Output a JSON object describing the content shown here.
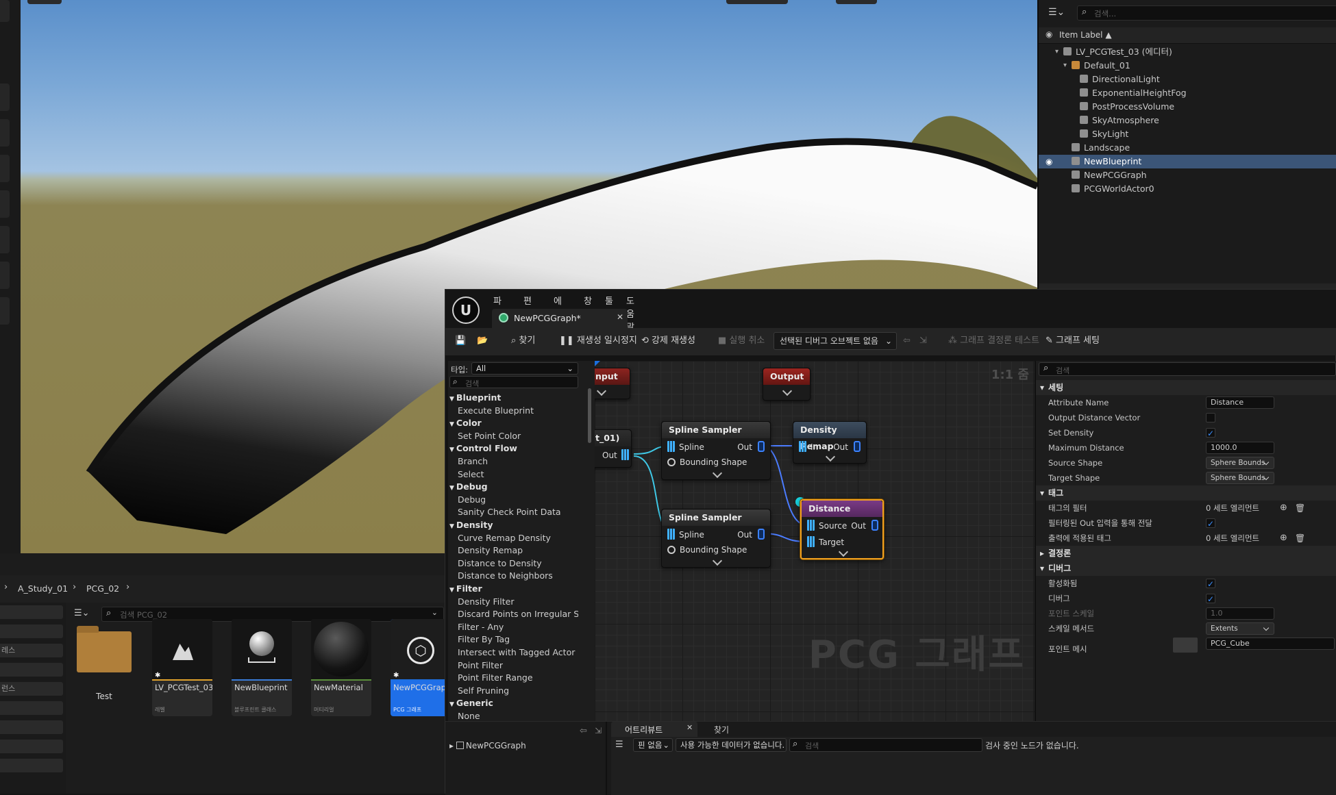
{
  "outliner": {
    "search_placeholder": "검색...",
    "column_label": "Item Label ▲",
    "items": [
      {
        "label": "LV_PCGTest_03 (에디터)",
        "indent": 0
      },
      {
        "label": "Default_01",
        "indent": 1
      },
      {
        "label": "DirectionalLight",
        "indent": 2
      },
      {
        "label": "ExponentialHeightFog",
        "indent": 2
      },
      {
        "label": "PostProcessVolume",
        "indent": 2
      },
      {
        "label": "SkyAtmosphere",
        "indent": 2
      },
      {
        "label": "SkyLight",
        "indent": 2
      },
      {
        "label": "Landscape",
        "indent": 1
      },
      {
        "label": "NewBlueprint",
        "indent": 1,
        "selected": true
      },
      {
        "label": "NewPCGGraph",
        "indent": 1
      },
      {
        "label": "PCGWorldActor0",
        "indent": 1
      }
    ]
  },
  "content_browser": {
    "breadcrumb": [
      "A_Study_01",
      "PCG_02"
    ],
    "search_placeholder": "검색 PCG_02",
    "side_labels": [
      "레스",
      "런스"
    ],
    "assets": [
      {
        "name": "Test",
        "type": "",
        "kind": "folder"
      },
      {
        "name": "LV_PCGTest_03",
        "type": "레벨",
        "kind": "level",
        "accent": "#e0a22c"
      },
      {
        "name": "NewBlueprint",
        "type": "블루프린트 클래스",
        "kind": "blueprint",
        "accent": "#3b7cd8"
      },
      {
        "name": "NewMaterial",
        "type": "머티리얼",
        "kind": "material",
        "accent": "#5a8f3a"
      },
      {
        "name": "NewPCGGraph",
        "type": "PCG 그래프",
        "kind": "pcg",
        "accent": "#1e6fe0",
        "selected": true
      }
    ]
  },
  "pcg_editor": {
    "menu": [
      "파일",
      "편집",
      "에셋",
      "창",
      "툴",
      "도움말"
    ],
    "tab_title": "NewPCGGraph*",
    "toolbar": {
      "find": "찾기",
      "pause": "재생성 일시정지",
      "force": "강제 재생성",
      "undo_run": "실행 취소",
      "debug_object": "선택된 디버그 오브젝트 없음",
      "determinism": "그래프 결정론 테스트",
      "settings": "그래프 세팅"
    },
    "palette": {
      "type_label": "타입:",
      "type_value": "All",
      "search_placeholder": "검색",
      "items": [
        {
          "label": "Blueprint",
          "cat": true
        },
        {
          "label": "Execute Blueprint",
          "cat": false
        },
        {
          "label": "Color",
          "cat": true
        },
        {
          "label": "Set Point Color",
          "cat": false
        },
        {
          "label": "Control Flow",
          "cat": true
        },
        {
          "label": "Branch",
          "cat": false
        },
        {
          "label": "Select",
          "cat": false
        },
        {
          "label": "Debug",
          "cat": true
        },
        {
          "label": "Debug",
          "cat": false
        },
        {
          "label": "Sanity Check Point Data",
          "cat": false
        },
        {
          "label": "Density",
          "cat": true
        },
        {
          "label": "Curve Remap Density",
          "cat": false
        },
        {
          "label": "Density Remap",
          "cat": false
        },
        {
          "label": "Distance to Density",
          "cat": false
        },
        {
          "label": "Distance to Neighbors",
          "cat": false
        },
        {
          "label": "Filter",
          "cat": true
        },
        {
          "label": "Density Filter",
          "cat": false
        },
        {
          "label": "Discard Points on Irregular Sur",
          "cat": false
        },
        {
          "label": "Filter - Any",
          "cat": false
        },
        {
          "label": "Filter By Tag",
          "cat": false
        },
        {
          "label": "Intersect with Tagged Actor Ge",
          "cat": false
        },
        {
          "label": "Point Filter",
          "cat": false
        },
        {
          "label": "Point Filter Range",
          "cat": false
        },
        {
          "label": "Self Pruning",
          "cat": false
        },
        {
          "label": "Generic",
          "cat": true
        },
        {
          "label": "None",
          "cat": false
        }
      ]
    },
    "graph": {
      "zoom": "1:1 줌",
      "watermark": "PCG 그래프",
      "input_node": "nput",
      "actor_node": "t_01)",
      "actor_out": "Out",
      "output_node": "Output",
      "spline1": {
        "title": "Spline Sampler",
        "in1": "Spline",
        "in2": "Bounding Shape",
        "out": "Out"
      },
      "spline2": {
        "title": "Spline Sampler",
        "in1": "Spline",
        "in2": "Bounding Shape",
        "out": "Out"
      },
      "remap": {
        "title": "Density Remap",
        "in": "In",
        "out": "Out"
      },
      "distance": {
        "title": "Distance",
        "in1": "Source",
        "in2": "Target",
        "out": "Out"
      }
    },
    "details": {
      "search_placeholder": "검색",
      "sections": {
        "settings": "세팅",
        "tags": "태그",
        "determinism": "결정론",
        "debug": "디버그"
      },
      "attribute_name": {
        "label": "Attribute Name",
        "value": "Distance"
      },
      "output_distance_vector": {
        "label": "Output Distance Vector",
        "checked": false
      },
      "set_density": {
        "label": "Set Density",
        "checked": true
      },
      "max_distance": {
        "label": "Maximum Distance",
        "value": "1000.0"
      },
      "source_shape": {
        "label": "Source Shape",
        "value": "Sphere Bounds"
      },
      "target_shape": {
        "label": "Target Shape",
        "value": "Sphere Bounds"
      },
      "tag_filter": {
        "label": "태그의 필터",
        "value": "0 세트 엘리먼트"
      },
      "pass_through": {
        "label": "필터링된 Out 입력을 통해 전달",
        "checked": true
      },
      "applied_tags": {
        "label": "출력에 적용된 태그",
        "value": "0 세트 엘리먼트"
      },
      "enabled": {
        "label": "활성화됨",
        "checked": true
      },
      "debug": {
        "label": "디버그",
        "checked": true
      },
      "point_scale": {
        "label": "포인트 스케일",
        "value": "1.0"
      },
      "scale_method": {
        "label": "스케일 메서드",
        "value": "Extents"
      },
      "point_mesh": {
        "label": "포인트 메시",
        "value": "PCG_Cube"
      }
    },
    "bottom": {
      "tree_item": "NewPCGGraph",
      "tab_attributes": "어트리뷰트",
      "tab_find": "찾기",
      "pin_filter": "핀 없음",
      "data_filter": "사용 가능한 데이터가 없습니다.",
      "search_placeholder": "검색",
      "status": "검사 중인 노드가 없습니다."
    }
  }
}
